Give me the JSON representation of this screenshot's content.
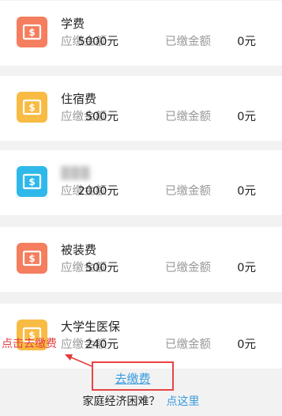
{
  "fees": [
    {
      "name": "学费",
      "due_label": "应缴金额",
      "due_amount": "5000元",
      "paid_label": "已缴金额",
      "paid_amount": "0元",
      "icon": "dollar-bill-icon",
      "icon_color": "#f47e5e"
    },
    {
      "name": "住宿费",
      "due_label": "应缴金额",
      "due_amount": "500元",
      "paid_label": "已缴金额",
      "paid_amount": "0元",
      "icon": "dollar-bill-icon",
      "icon_color": "#f8bb44"
    },
    {
      "name": "▒▒▒",
      "due_label": "应缴金额",
      "due_amount": "2000元",
      "paid_label": "已缴金额",
      "paid_amount": "0元",
      "icon": "dollar-bill-icon",
      "icon_color": "#2fb8ea"
    },
    {
      "name": "被装费",
      "due_label": "应缴金额",
      "due_amount": "500元",
      "paid_label": "已缴金额",
      "paid_amount": "0元",
      "icon": "dollar-bill-icon",
      "icon_color": "#f47e5e"
    },
    {
      "name": "大学生医保",
      "due_label": "应缴金额",
      "due_amount": "240元",
      "paid_label": "已缴金额",
      "paid_amount": "0元",
      "icon": "dollar-bill-icon",
      "icon_color": "#f8bb44"
    }
  ],
  "pay_button": {
    "label": "去缴费"
  },
  "annotation": {
    "text": "点击去缴费",
    "color": "#e23d3d"
  },
  "help": {
    "text": "家庭经济困难？",
    "link": "点这里"
  },
  "colors": {
    "link": "#3a9be0",
    "page_bg": "#f2f2f2",
    "card_bg": "#ffffff"
  }
}
